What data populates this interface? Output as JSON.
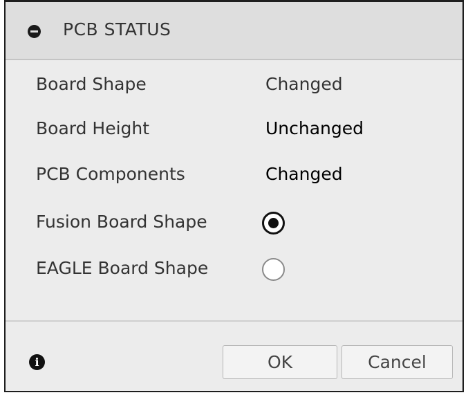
{
  "panel": {
    "title": "PCB STATUS"
  },
  "rows": [
    {
      "label": "Board Shape",
      "value": "Changed"
    },
    {
      "label": "Board Height",
      "value": "Unchanged"
    },
    {
      "label": "PCB Components",
      "value": "Changed"
    }
  ],
  "board_shape_options": [
    {
      "label": "Fusion Board Shape",
      "selected": true
    },
    {
      "label": "EAGLE Board Shape",
      "selected": false
    }
  ],
  "footer": {
    "info_icon": "info-icon",
    "info_glyph": "i",
    "ok_label": "OK",
    "cancel_label": "Cancel"
  },
  "colors": {
    "panel_bg": "#ececec",
    "header_bg": "#dedede",
    "border": "#1e1e1e"
  }
}
